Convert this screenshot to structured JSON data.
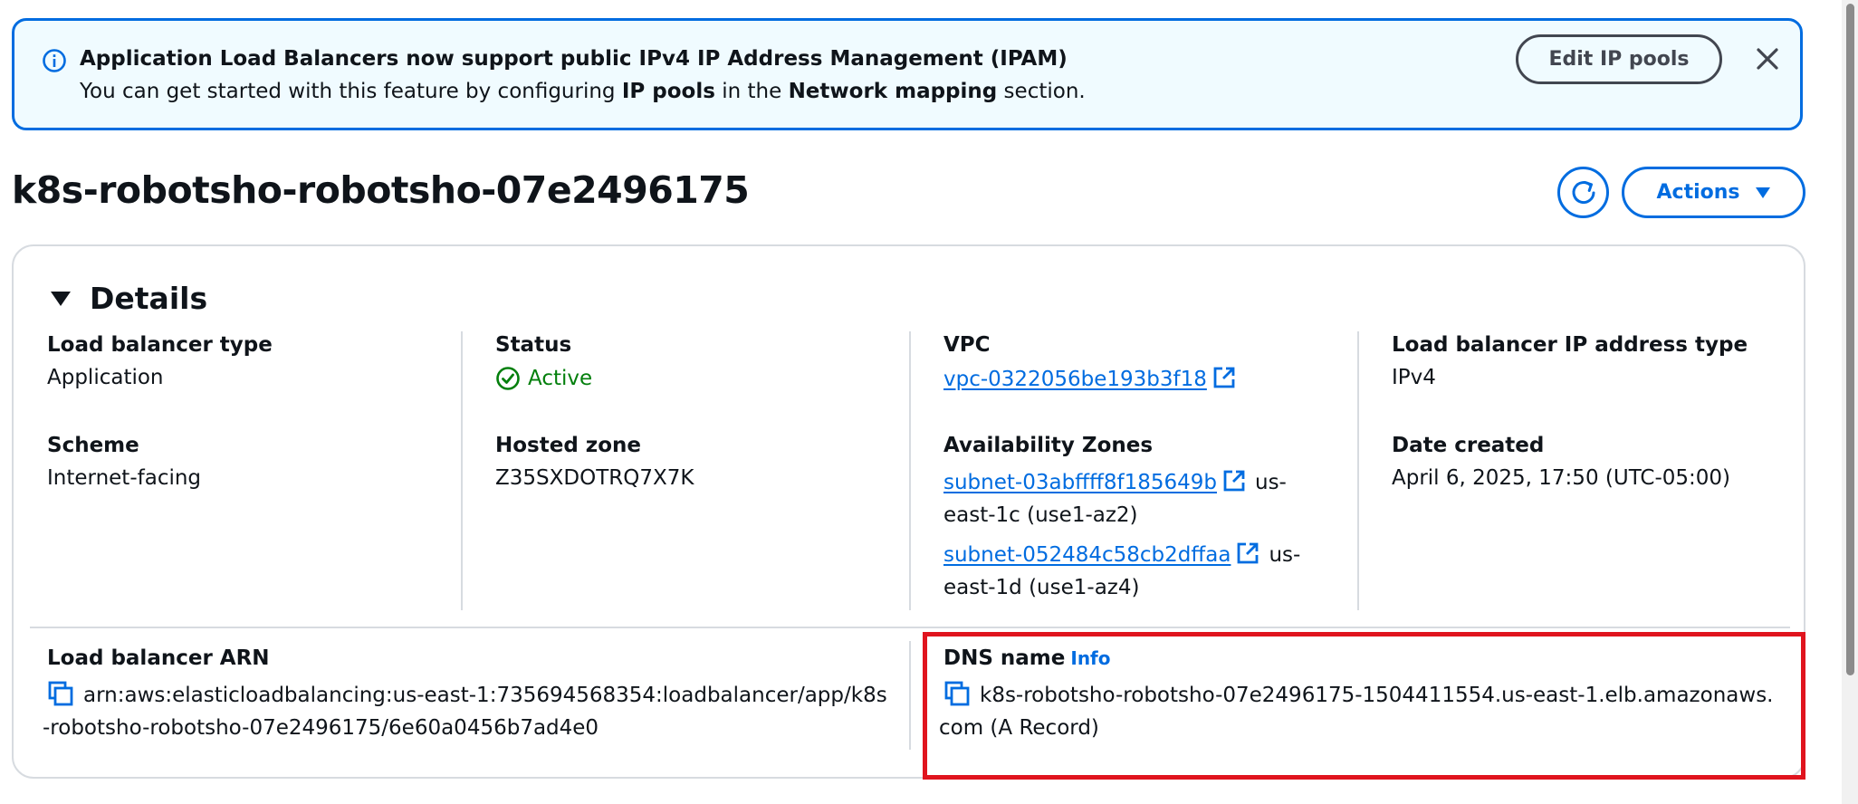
{
  "banner": {
    "title": "Application Load Balancers now support public IPv4 IP Address Management (IPAM)",
    "msg_part1": "You can get started with this feature by configuring ",
    "msg_bold1": "IP pools",
    "msg_part2": " in the ",
    "msg_bold2": "Network mapping",
    "msg_part3": " section.",
    "edit_button": "Edit IP pools"
  },
  "page": {
    "title": "k8s-robotsho-robotsho-07e2496175",
    "actions_label": "Actions"
  },
  "details": {
    "heading": "Details",
    "load_balancer_type": {
      "label": "Load balancer type",
      "value": "Application"
    },
    "scheme": {
      "label": "Scheme",
      "value": "Internet-facing"
    },
    "status": {
      "label": "Status",
      "value": "Active"
    },
    "hosted_zone": {
      "label": "Hosted zone",
      "value": "Z35SXDOTRQ7X7K"
    },
    "vpc": {
      "label": "VPC",
      "value": "vpc-0322056be193b3f18"
    },
    "availability_zones": {
      "label": "Availability Zones",
      "items": [
        {
          "subnet": "subnet-03abffff8f185649b",
          "zone": "us-east-1c (use1-az2)"
        },
        {
          "subnet": "subnet-052484c58cb2dffaa",
          "zone": "us-east-1d (use1-az4)"
        }
      ]
    },
    "ip_address_type": {
      "label": "Load balancer IP address type",
      "value": "IPv4"
    },
    "date_created": {
      "label": "Date created",
      "value": "April 6, 2025, 17:50 (UTC-05:00)"
    },
    "arn": {
      "label": "Load balancer ARN",
      "value": "arn:aws:elasticloadbalancing:us-east-1:735694568354:loadbalancer/app/k8s-robotsho-robotsho-07e2496175/6e60a0456b7ad4e0"
    },
    "dns_name": {
      "label": "DNS name",
      "info": "Info",
      "value": "k8s-robotsho-robotsho-07e2496175-1504411554.us-east-1.elb.amazonaws.com (A Record)"
    }
  },
  "colors": {
    "link": "#006ce0",
    "success": "#037f0c",
    "highlight": "#e0141e",
    "banner_bg": "#f0fbff"
  }
}
